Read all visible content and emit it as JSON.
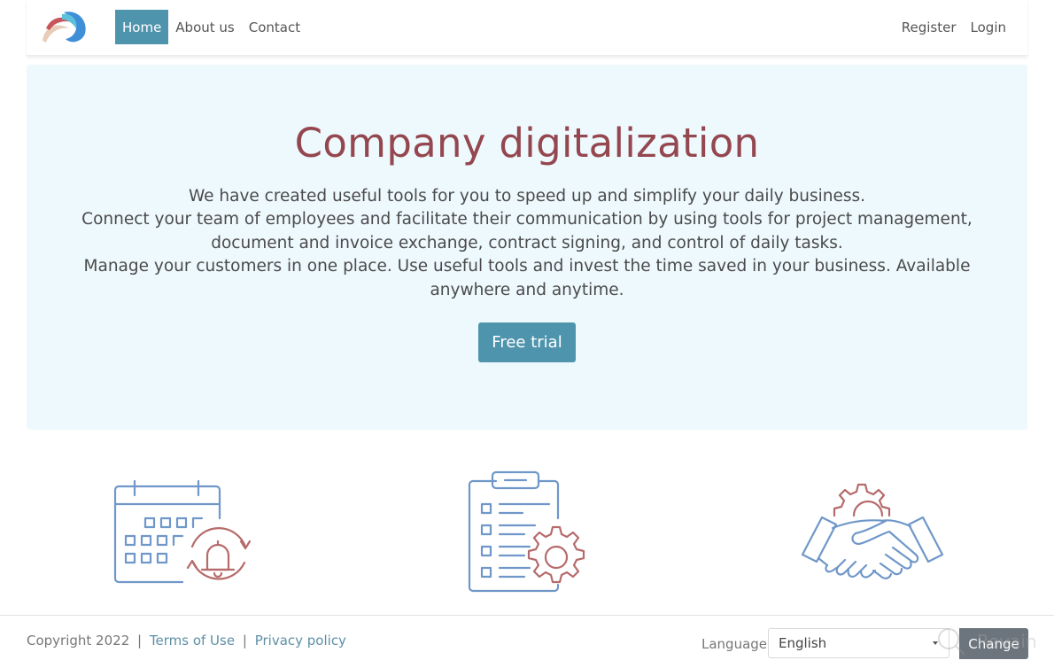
{
  "nav": {
    "logo_label": "Company logo",
    "left_links": [
      {
        "label": "Home",
        "active": true
      },
      {
        "label": "About us",
        "active": false
      },
      {
        "label": "Contact",
        "active": false
      }
    ],
    "right_links": [
      {
        "label": "Register"
      },
      {
        "label": "Login"
      }
    ]
  },
  "hero": {
    "title": "Company digitalization",
    "lines": [
      "We have created useful tools for you to speed up and simplify your daily business.",
      "Connect your team of employees and facilitate their communication by using tools for project management, document and invoice exchange, contract signing, and control of daily tasks.",
      "Manage your customers in one place. Use useful tools and invest the time saved in your business. Available anywhere and anytime."
    ],
    "cta_label": "Free trial"
  },
  "features": [
    {
      "icon": "calendar-reminder-icon"
    },
    {
      "icon": "checklist-settings-icon"
    },
    {
      "icon": "handshake-gear-icon"
    }
  ],
  "footer": {
    "copyright": "Copyright 2022",
    "separator": "|",
    "terms_label": "Terms of Use",
    "privacy_label": "Privacy policy",
    "language_label": "Language",
    "language_value": "English",
    "change_label": "Change",
    "watermark": "Revain"
  },
  "colors": {
    "accent": "#4f94ad",
    "title": "#94474f",
    "hero_bg": "#eef9fd",
    "icon_blue": "#6f97c9",
    "icon_red": "#b66a6a",
    "button_secondary": "#6c757d"
  }
}
